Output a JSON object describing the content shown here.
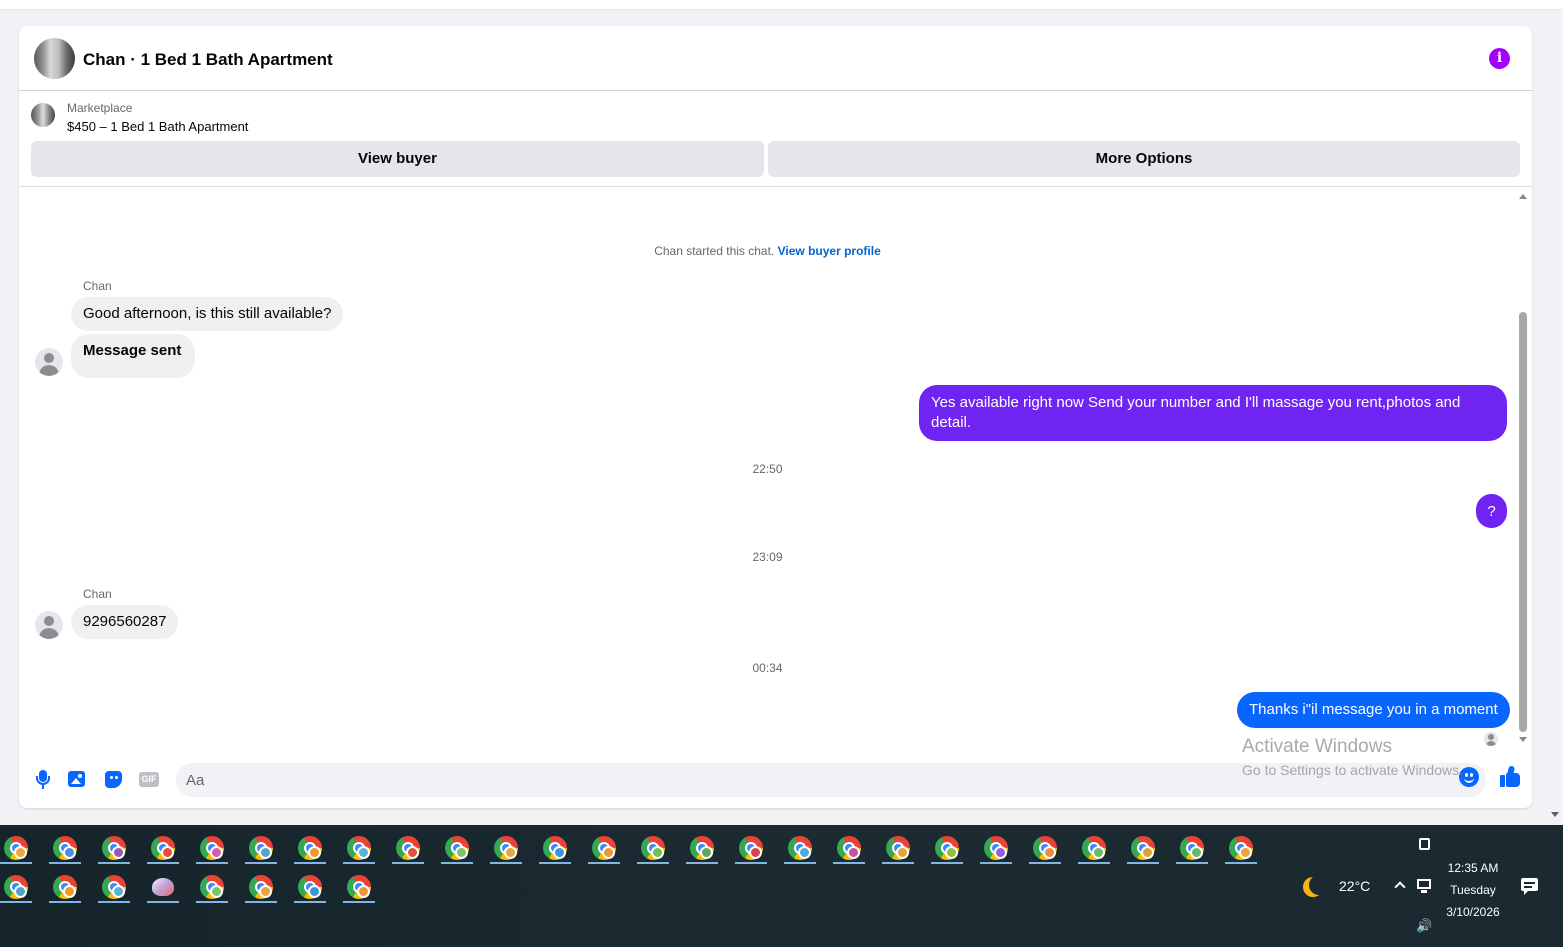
{
  "header": {
    "title": "Chan · 1 Bed 1 Bath Apartment",
    "info_icon": "info-icon"
  },
  "listing": {
    "label": "Marketplace",
    "price_line": "$450 – 1 Bed 1 Bath Apartment",
    "view_buyer": "View buyer",
    "more_options": "More Options"
  },
  "chat": {
    "system_note": "Chan started this chat.",
    "system_link": "View buyer profile",
    "sender_name": "Chan",
    "messages": [
      {
        "from": "Chan",
        "text": "Good afternoon, is this still available?"
      },
      {
        "from": "Chan",
        "text": "Message sent"
      },
      {
        "from": "me",
        "text": "Yes available right now Send your number and I'll massage you rent,photos and detail."
      },
      {
        "from": "me",
        "text": "?"
      },
      {
        "from": "Chan",
        "text": "9296560287"
      },
      {
        "from": "me",
        "text": "Thanks i\"il message you in a moment"
      }
    ],
    "timestamps": [
      "22:50",
      "23:09",
      "00:34"
    ]
  },
  "composer": {
    "placeholder": "Aa",
    "gif_label": "GIF",
    "icons": [
      "microphone-icon",
      "photo-icon",
      "sticker-icon",
      "gif-icon",
      "emoji-icon",
      "like-icon"
    ]
  },
  "watermark": {
    "line1": "Activate Windows",
    "line2": "Go to Settings to activate Windows."
  },
  "taskbar": {
    "weather_temp": "22°C",
    "time": "12:35 AM",
    "day": "Tuesday",
    "date": "3/10/2026",
    "volume_glyph": "🔊"
  },
  "colors": {
    "accent_purple": "#7024f1",
    "accent_blue": "#0866ff",
    "info_purple": "#a400ff"
  }
}
